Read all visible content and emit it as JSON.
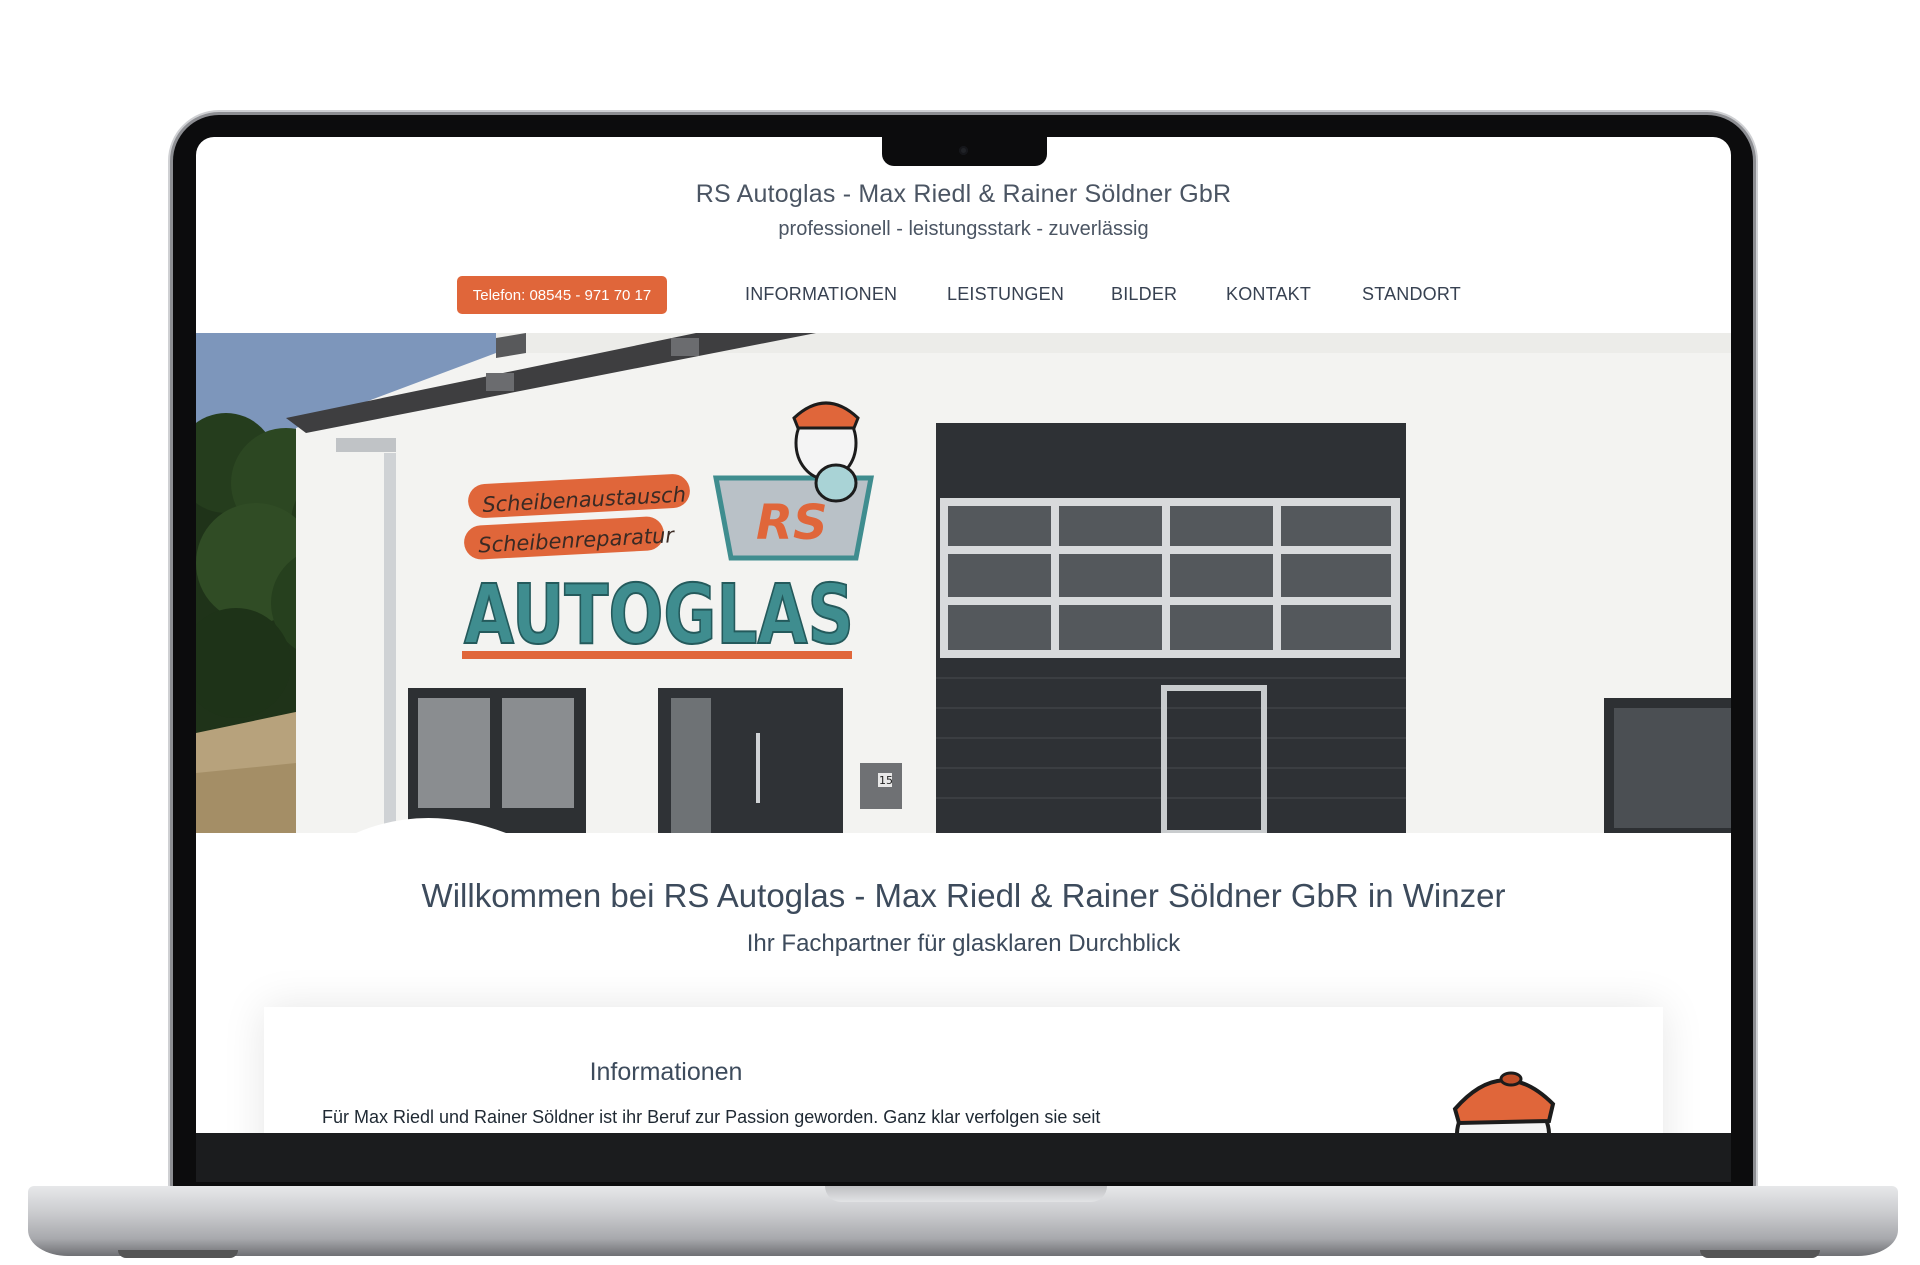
{
  "header": {
    "site_title": "RS Autoglas - Max Riedl & Rainer Söldner GbR",
    "tagline": "professionell - leistungsstark - zuverlässig",
    "phone_label": "Telefon: 08545 - 971 70 17"
  },
  "nav": {
    "items": [
      {
        "label": "INFORMATIONEN"
      },
      {
        "label": "LEISTUNGEN"
      },
      {
        "label": "BILDER"
      },
      {
        "label": "KONTAKT"
      },
      {
        "label": "STANDORT"
      }
    ]
  },
  "hero": {
    "sign_line1": "Scheibenaustausch",
    "sign_line2": "Scheibenreparatur",
    "sign_main": "AUTOGLAS",
    "logo_text": "RS",
    "house_number": "15"
  },
  "welcome": {
    "heading": "Willkommen bei RS Autoglas - Max Riedl & Rainer Söldner GbR in Winzer",
    "subheading": "Ihr Fachpartner für glasklaren Durchblick"
  },
  "info": {
    "title": "Informationen",
    "text": "Für Max Riedl und Rainer Söldner ist ihr Beruf zur Passion geworden. Ganz klar verfolgen sie seit"
  },
  "colors": {
    "accent_orange": "#e0663a",
    "sign_teal": "#3f8d8f",
    "text_slate": "#3d4b5c"
  }
}
